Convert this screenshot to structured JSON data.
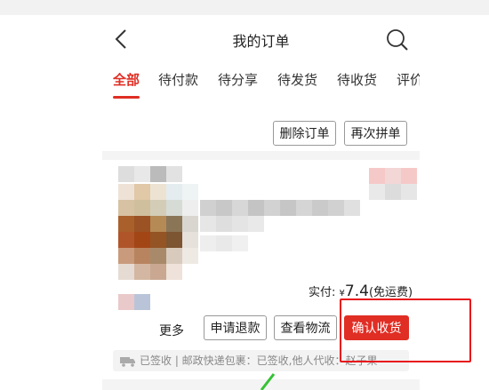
{
  "header": {
    "title": "我的订单"
  },
  "tabs": [
    {
      "label": "全部",
      "active": true
    },
    {
      "label": "待付款"
    },
    {
      "label": "待分享"
    },
    {
      "label": "待发货"
    },
    {
      "label": "待收货"
    },
    {
      "label": "评价"
    }
  ],
  "order1": {
    "delete_label": "删除订单",
    "rebuy_label": "再次拼单"
  },
  "order2": {
    "paid_label": "实付:",
    "currency": "¥",
    "amount": "7.4",
    "shipping_note": "(免运费)",
    "more_label": "更多",
    "refund_label": "申请退款",
    "logistics_button_label": "查看物流",
    "confirm_label": "确认收货",
    "logistics_status": "已签收 | 邮政快递包裹：已签收,他人代收：赵子果"
  },
  "colors": {
    "accent": "#e02e24",
    "highlight_box": "#e8141c",
    "arrow": "#35c235"
  },
  "icons": [
    "back-arrow-icon",
    "search-icon",
    "truck-icon"
  ]
}
